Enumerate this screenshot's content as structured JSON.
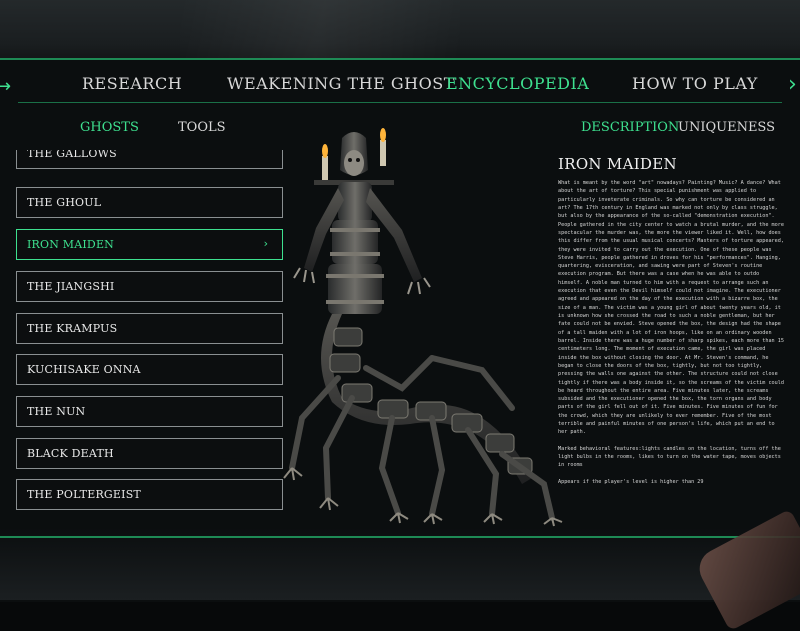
{
  "nav": {
    "tabs": [
      {
        "label": "RESEARCH",
        "active": false
      },
      {
        "label": "WEAKENING THE GHOST",
        "active": false
      },
      {
        "label": "ENCYCLOPEDIA",
        "active": true
      },
      {
        "label": "HOW TO PLAY",
        "active": false
      }
    ],
    "prev_arrow": "→",
    "next_arrow": "›"
  },
  "left_subtabs": [
    {
      "label": "GHOSTS",
      "active": true
    },
    {
      "label": "TOOLS",
      "active": false
    }
  ],
  "right_subtabs": [
    {
      "label": "DESCRIPTION",
      "active": true
    },
    {
      "label": "UNIQUENESS",
      "active": false
    }
  ],
  "ghost_list": {
    "items": [
      {
        "label": "THE GALLOWS",
        "active": false
      },
      {
        "label": "THE GHOUL",
        "active": false
      },
      {
        "label": "IRON MAIDEN",
        "active": true
      },
      {
        "label": "THE JIANGSHI",
        "active": false
      },
      {
        "label": "THE KRAMPUS",
        "active": false
      },
      {
        "label": "KUCHISAKE ONNA",
        "active": false
      },
      {
        "label": "THE NUN",
        "active": false
      },
      {
        "label": "BLACK DEATH",
        "active": false
      },
      {
        "label": "THE POLTERGEIST",
        "active": false
      }
    ],
    "active_chevron": "›"
  },
  "description": {
    "title": "IRON MAIDEN",
    "paragraphs": [
      "What is meant by the word \"art\" nowadays? Painting? Music? A dance? What about the art of torture? This special punishment was applied to particularly inveterate criminals. So why can torture be considered an art? The 17th century in England was marked not only by class struggle, but also by the appearance of the so-called \"demonstration execution\". People gathered in the city center to watch a brutal murder, and the more spectacular the murder was, the more the viewer liked it. Well, how does this differ from the usual musical concerts? Masters of torture appeared, they were invited to carry out the execution. One of these people was Steve Harris, people gathered in droves for his \"performances\". Hanging, quartering, evisceration, and sawing were part of Steven's routine execution program. But there was a case when he was able to outdo himself. A noble man turned to him with a request to arrange such an execution that even the Devil himself could not imagine. The executioner agreed and appeared on the day of the execution with a bizarre box, the size of a man. The victim was a young girl of about twenty years old, it is unknown how she crossed the road to such a noble gentleman, but her fate could not be envied. Steve opened the box, the design had the shape of a tall maiden with a lot of iron hoops, like on an ordinary wooden barrel. Inside there was a huge number of sharp spikes, each more than 15 centimeters long. The moment of execution came, the girl was placed inside the box without closing the door. At Mr. Steven's command, he began to close the doors of the box, tightly, but not too tightly, pressing the walls one against the other. The structure could not close tightly if there was a body inside it, so the screams of the victim could be heard throughout the entire area. Five minutes later, the screams subsided and the executioner opened the box, the torn organs and body parts of the girl fell out of it. Five minutes. Five minutes of fun for the crowd, which they are unlikely to ever remember. Five of the most terrible and painful minutes of one person's life, which put an end to her path.",
      "Marked behavioral features:lights candles on the location, turns off the light bulbs in the rooms, likes to turn on the water tape, moves objects in rooms",
      "Appears if the player's level is higher than 29"
    ]
  },
  "colors": {
    "accent": "#3ee08f",
    "accent_line": "#1e8a55",
    "text": "#e4e4e4",
    "item_border": "#8a8f91",
    "background": "#0b0e0f"
  }
}
